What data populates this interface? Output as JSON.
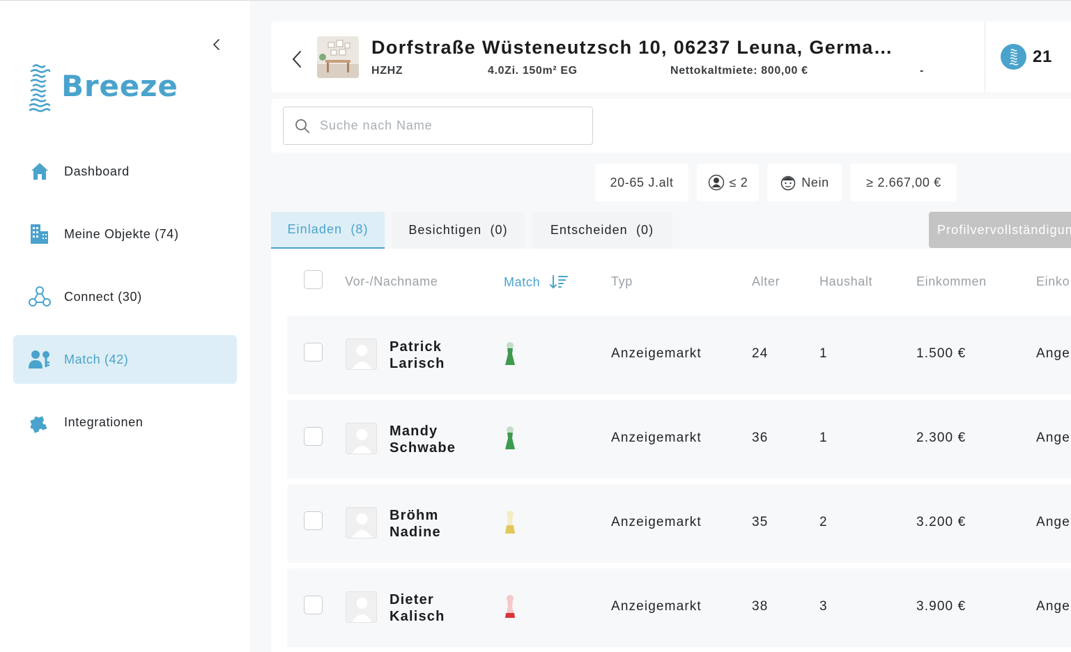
{
  "sidebar": {
    "brand": "Breeze",
    "items": [
      {
        "label": "Dashboard",
        "icon": "home-icon"
      },
      {
        "label": "Meine Objekte (74)",
        "icon": "buildings-icon"
      },
      {
        "label": "Connect (30)",
        "icon": "connect-icon"
      },
      {
        "label": "Match (42)",
        "icon": "match-icon",
        "active": true
      },
      {
        "label": "Integrationen",
        "icon": "puzzle-icon"
      }
    ]
  },
  "property": {
    "address": "Dorfstraße Wüsteneutzsch 10, 06237 Leuna, Germa…",
    "code": "HZHZ",
    "details": "4.0Zi. 150m² EG",
    "rent": "Nettokaltmiete: 800,00 €",
    "extra": "-",
    "counter": "21"
  },
  "search": {
    "placeholder": "Suche nach Name"
  },
  "filters": [
    {
      "label": "20-65 J.alt"
    },
    {
      "label": "≤ 2",
      "icon": "person-icon"
    },
    {
      "label": "Nein",
      "icon": "kid-icon"
    },
    {
      "label": "≥ 2.667,00 €"
    }
  ],
  "tabs": [
    {
      "label": "Einladen",
      "count": "(8)"
    },
    {
      "label": "Besichtigen",
      "count": "(0)"
    },
    {
      "label": "Entscheiden",
      "count": "(0)"
    }
  ],
  "profile_button": "Profilvervollständigung",
  "table": {
    "columns": {
      "name": "Vor-/Nachname",
      "match": "Match",
      "type": "Typ",
      "age": "Alter",
      "household": "Haushalt",
      "income": "Einkommen",
      "more": "Einko"
    },
    "rows": [
      {
        "first": "Patrick",
        "last": "Larisch",
        "match": "green",
        "type": "Anzeigemarkt",
        "age": "24",
        "household": "1",
        "income": "1.500 €",
        "more": "Ange"
      },
      {
        "first": "Mandy",
        "last": "Schwabe",
        "match": "green",
        "type": "Anzeigemarkt",
        "age": "36",
        "household": "1",
        "income": "2.300 €",
        "more": "Ange"
      },
      {
        "first": "Bröhm",
        "last": "Nadine",
        "match": "yellow",
        "type": "Anzeigemarkt",
        "age": "35",
        "household": "2",
        "income": "3.200 €",
        "more": "Ange"
      },
      {
        "first": "Dieter",
        "last": "Kalisch",
        "match": "red",
        "type": "Anzeigemarkt",
        "age": "38",
        "household": "3",
        "income": "3.900 €",
        "more": "Ange"
      }
    ]
  },
  "colors": {
    "accent": "#4aa3cc",
    "match_green": "#3e9a4e",
    "match_yellow": "#e2c85a",
    "match_red": "#d8363a"
  }
}
